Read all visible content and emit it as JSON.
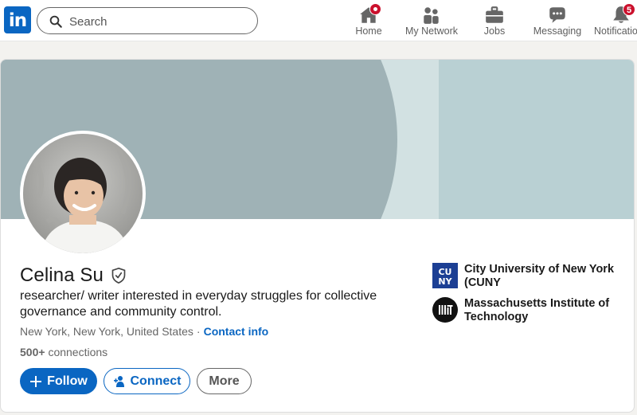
{
  "nav": {
    "logo_text": "in",
    "search_placeholder": "Search",
    "items": [
      {
        "label": "Home",
        "icon": "home-icon",
        "badge": ""
      },
      {
        "label": "My Network",
        "icon": "network-icon",
        "badge": ""
      },
      {
        "label": "Jobs",
        "icon": "briefcase-icon",
        "badge": ""
      },
      {
        "label": "Messaging",
        "icon": "messaging-icon",
        "badge": ""
      },
      {
        "label": "Notifications",
        "icon": "bell-icon",
        "badge": "5"
      }
    ]
  },
  "profile": {
    "name": "Celina Su",
    "headline": "researcher/ writer interested in everyday struggles for collective governance and community control.",
    "location": "New York, New York, United States",
    "separator": "·",
    "contact_label": "Contact info",
    "connections_count": "500+",
    "connections_label": "connections",
    "buttons": {
      "follow": "Follow",
      "connect": "Connect",
      "more": "More"
    },
    "organizations": [
      {
        "name": "City University of New York (CUNY",
        "logo_text": "CUNY"
      },
      {
        "name": "Massachusetts Institute of Technology",
        "logo_text": "MIT"
      }
    ]
  },
  "colors": {
    "brand": "#0a66c2",
    "badge": "#cb112d",
    "banner_dark": "#9fb2b6",
    "banner_light": "#b9d0d3"
  }
}
